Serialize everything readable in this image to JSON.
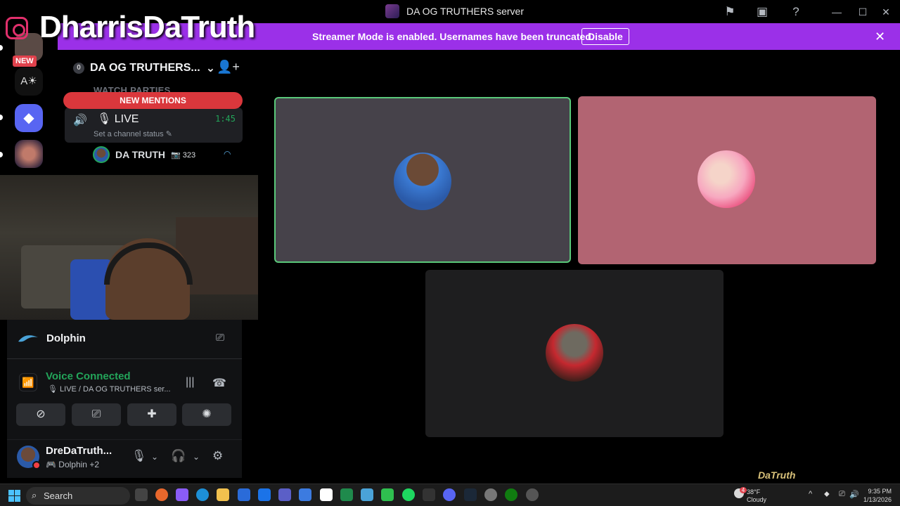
{
  "window": {
    "title": "DA OG TRUTHERS server"
  },
  "banner": {
    "message": "Streamer Mode is enabled. Usernames have been truncated.",
    "disable_label": "Disable"
  },
  "overlay": {
    "brand_text": "DharrisDaTruth",
    "new_badge": "NEW",
    "watermark": "DaTruth"
  },
  "rail": {
    "items": [
      {
        "label": "A☀"
      }
    ]
  },
  "sidebar": {
    "guild_name": "DA OG TRUTHERS...",
    "guild_badge": "0",
    "category": "WATCH PARTIES",
    "new_mentions": "NEW MENTIONS",
    "channel": {
      "name": "LIVE",
      "time": "1:45",
      "status": "Set a channel status"
    },
    "member": {
      "name": "DA TRUTH",
      "level": "323"
    }
  },
  "panel": {
    "activity_app": "Dolphin",
    "voice_title": "Voice Connected",
    "voice_channel": "LIVE / DA OG TRUTHERS ser...",
    "user": {
      "name": "DreDaTruth...",
      "activity": "Dolphin",
      "activity_more": "+2"
    }
  },
  "taskbar": {
    "search_placeholder": "Search",
    "weather_temp": "38°F",
    "weather_cond": "Cloudy",
    "weather_badge": "4",
    "time": "9:35 PM",
    "date": "1/13/2026"
  },
  "colors": {
    "banner": "#9b30e8",
    "voice_green": "#23a55a",
    "mentions_red": "#da373c",
    "tile_speaking_border": "#5ac97a"
  }
}
